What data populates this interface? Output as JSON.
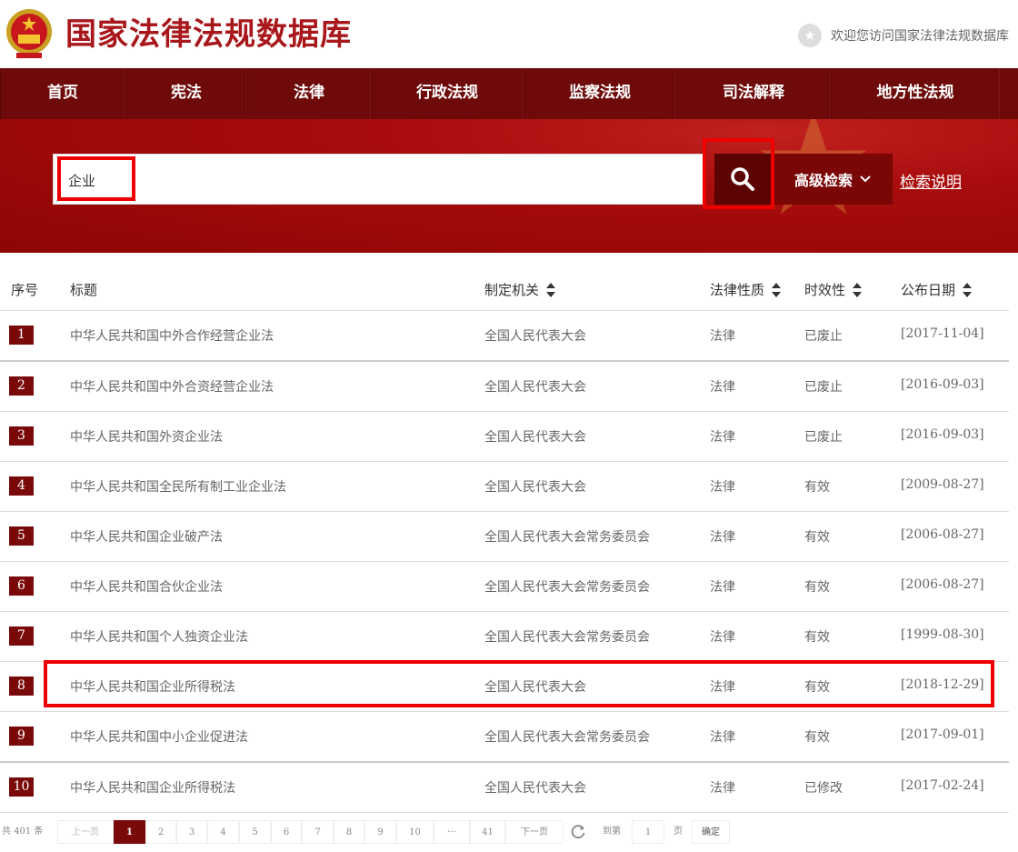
{
  "header": {
    "title": "国家法律法规数据库",
    "welcome": "欢迎您访问国家法律法规数据库"
  },
  "nav": [
    "首页",
    "宪法",
    "法律",
    "行政法规",
    "监察法规",
    "司法解释",
    "地方性法规"
  ],
  "search": {
    "value": "企业",
    "advanced_label": "高级检索",
    "help_label": "检索说明"
  },
  "table": {
    "headers": {
      "index": "序号",
      "title": "标题",
      "authority": "制定机关",
      "nature": "法律性质",
      "validity": "时效性",
      "date": "公布日期"
    },
    "rows": [
      {
        "index": "1",
        "title": "中华人民共和国中外合作经营企业法",
        "authority": "全国人民代表大会",
        "nature": "法律",
        "validity": "已废止",
        "date": "[2017-11-04]"
      },
      {
        "index": "2",
        "title": "中华人民共和国中外合资经营企业法",
        "authority": "全国人民代表大会",
        "nature": "法律",
        "validity": "已废止",
        "date": "[2016-09-03]"
      },
      {
        "index": "3",
        "title": "中华人民共和国外资企业法",
        "authority": "全国人民代表大会",
        "nature": "法律",
        "validity": "已废止",
        "date": "[2016-09-03]"
      },
      {
        "index": "4",
        "title": "中华人民共和国全民所有制工业企业法",
        "authority": "全国人民代表大会",
        "nature": "法律",
        "validity": "有效",
        "date": "[2009-08-27]"
      },
      {
        "index": "5",
        "title": "中华人民共和国企业破产法",
        "authority": "全国人民代表大会常务委员会",
        "nature": "法律",
        "validity": "有效",
        "date": "[2006-08-27]"
      },
      {
        "index": "6",
        "title": "中华人民共和国合伙企业法",
        "authority": "全国人民代表大会常务委员会",
        "nature": "法律",
        "validity": "有效",
        "date": "[2006-08-27]"
      },
      {
        "index": "7",
        "title": "中华人民共和国个人独资企业法",
        "authority": "全国人民代表大会常务委员会",
        "nature": "法律",
        "validity": "有效",
        "date": "[1999-08-30]"
      },
      {
        "index": "8",
        "title": "中华人民共和国企业所得税法",
        "authority": "全国人民代表大会",
        "nature": "法律",
        "validity": "有效",
        "date": "[2018-12-29]"
      },
      {
        "index": "9",
        "title": "中华人民共和国中小企业促进法",
        "authority": "全国人民代表大会常务委员会",
        "nature": "法律",
        "validity": "有效",
        "date": "[2017-09-01]"
      },
      {
        "index": "10",
        "title": "中华人民共和国企业所得税法",
        "authority": "全国人民代表大会",
        "nature": "法律",
        "validity": "已修改",
        "date": "[2017-02-24]"
      }
    ]
  },
  "pagination": {
    "total_prefix": "共",
    "total": "401",
    "total_suffix": "条",
    "prev": "上一页",
    "next": "下一页",
    "pages": [
      "1",
      "2",
      "3",
      "4",
      "5",
      "6",
      "7",
      "8",
      "9",
      "10",
      "···",
      "41"
    ],
    "current": "1",
    "goto_prefix": "到第",
    "goto_value": "1",
    "goto_suffix": "页",
    "confirm": "确定"
  },
  "colors": {
    "brand": "#a8171b",
    "nav_bg": "#6e0a0a",
    "highlight": "#e00000"
  }
}
